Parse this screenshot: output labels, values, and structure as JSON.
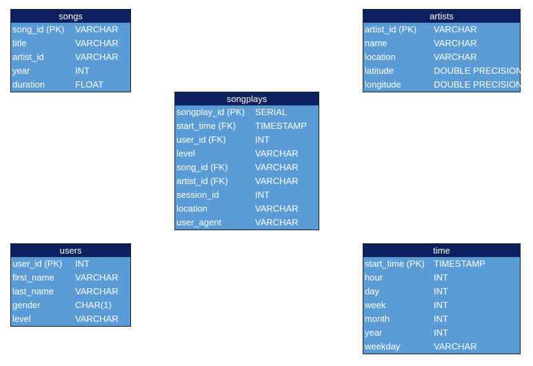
{
  "tables": {
    "songs": {
      "title": "songs",
      "rows": [
        {
          "name": "song_id (PK)",
          "type": "VARCHAR"
        },
        {
          "name": "title",
          "type": "VARCHAR"
        },
        {
          "name": "artist_id",
          "type": "VARCHAR"
        },
        {
          "name": "year",
          "type": "INT"
        },
        {
          "name": "duration",
          "type": "FLOAT"
        }
      ]
    },
    "artists": {
      "title": "artists",
      "rows": [
        {
          "name": "artist_id (PK)",
          "type": "VARCHAR"
        },
        {
          "name": "name",
          "type": "VARCHAR"
        },
        {
          "name": "location",
          "type": "VARCHAR"
        },
        {
          "name": "latitude",
          "type": "DOUBLE PRECISION"
        },
        {
          "name": "longitude",
          "type": "DOUBLE PRECISION"
        }
      ]
    },
    "songplays": {
      "title": "songplays",
      "rows": [
        {
          "name": "songplay_id (PK)",
          "type": "SERIAL"
        },
        {
          "name": "start_time (FK)",
          "type": "TIMESTAMP"
        },
        {
          "name": "user_id (FK)",
          "type": "INT"
        },
        {
          "name": "level",
          "type": "VARCHAR"
        },
        {
          "name": "song_id (FK)",
          "type": "VARCHAR"
        },
        {
          "name": "artist_id (FK)",
          "type": "VARCHAR"
        },
        {
          "name": "session_id",
          "type": "INT"
        },
        {
          "name": "location",
          "type": "VARCHAR"
        },
        {
          "name": "user_agent",
          "type": "VARCHAR"
        }
      ]
    },
    "users": {
      "title": "users",
      "rows": [
        {
          "name": "user_id (PK)",
          "type": "INT"
        },
        {
          "name": "first_name",
          "type": "VARCHAR"
        },
        {
          "name": "last_name",
          "type": "VARCHAR"
        },
        {
          "name": "gender",
          "type": "CHAR(1)"
        },
        {
          "name": "level",
          "type": "VARCHAR"
        }
      ]
    },
    "time": {
      "title": "time",
      "rows": [
        {
          "name": "start_time (PK)",
          "type": "TIMESTAMP"
        },
        {
          "name": "hour",
          "type": "INT"
        },
        {
          "name": "day",
          "type": "INT"
        },
        {
          "name": "week",
          "type": "INT"
        },
        {
          "name": "month",
          "type": "INT"
        },
        {
          "name": "year",
          "type": "INT"
        },
        {
          "name": "weekday",
          "type": "VARCHAR"
        }
      ]
    }
  },
  "colors": {
    "header": "#0d1f5c",
    "body": "#5b9bd5",
    "text": "#ffffff"
  }
}
